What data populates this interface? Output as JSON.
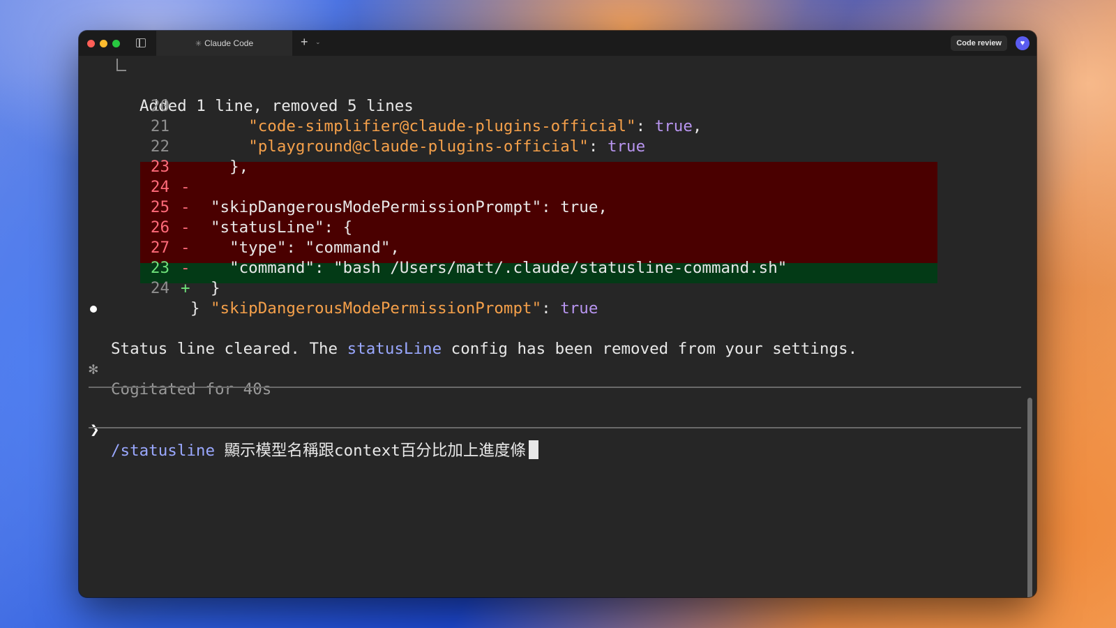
{
  "window": {
    "tab_title": "Claude Code",
    "code_review_label": "Code review"
  },
  "diff": {
    "summary": "Added 1 line, removed 5 lines",
    "lines": [
      {
        "num": "20",
        "sign": "",
        "type": "context",
        "indent": "    ",
        "key": "\"code-simplifier@claude-plugins-official\"",
        "sep": ": ",
        "value": "true",
        "tail": ","
      },
      {
        "num": "21",
        "sign": "",
        "type": "context",
        "indent": "    ",
        "key": "\"playground@claude-plugins-official\"",
        "sep": ": ",
        "value": "true",
        "tail": ""
      },
      {
        "num": "22",
        "sign": "",
        "type": "context",
        "text": "  },"
      },
      {
        "num": "23",
        "sign": "-",
        "type": "removed",
        "text": "\"skipDangerousModePermissionPrompt\": true,"
      },
      {
        "num": "24",
        "sign": "-",
        "type": "removed",
        "text": "\"statusLine\": {"
      },
      {
        "num": "25",
        "sign": "-",
        "type": "removed",
        "text": "  \"type\": \"command\","
      },
      {
        "num": "26",
        "sign": "-",
        "type": "removed",
        "text": "  \"command\": \"bash /Users/matt/.claude/statusline-command.sh\""
      },
      {
        "num": "27",
        "sign": "-",
        "type": "removed",
        "text": "}"
      },
      {
        "num": "23",
        "sign": "+",
        "type": "added",
        "key": "\"skipDangerousModePermissionPrompt\"",
        "sep": ": ",
        "value": "true"
      },
      {
        "num": "24",
        "sign": "",
        "type": "context",
        "text": "}"
      }
    ]
  },
  "message": {
    "before": "Status line cleared. The ",
    "highlight": "statusLine",
    "after": " config has been removed from your settings."
  },
  "status": {
    "icon": "✻",
    "text": "Cogitated for 40s"
  },
  "prompt": {
    "arrow": "❯",
    "command": "/statusline",
    "text": " 顯示模型名稱跟context百分比加上進度條"
  },
  "colors": {
    "removed_bg": "#4a0000",
    "added_bg": "#033a16",
    "string": "#f5a04a",
    "boolean": "#b895f0",
    "highlight": "#9aa8ff"
  }
}
